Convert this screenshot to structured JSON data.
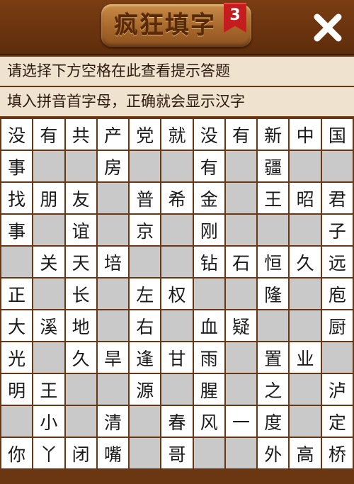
{
  "header": {
    "title": "疯狂填字",
    "level": "3",
    "close_icon": "close-icon"
  },
  "hints": [
    "请选择下方空格在此查看提示答题",
    "填入拼音首字母，正确就会显示汉字"
  ],
  "colors": {
    "board_border": "#6b3712",
    "cell_white": "#ffffff",
    "cell_block": "#c9c9c9",
    "hint_bg": "#efe2cf",
    "ribbon": "#c51d1d"
  },
  "grid": [
    [
      "没",
      "有",
      "共",
      "产",
      "党",
      "就",
      "没",
      "有",
      "新",
      "中",
      "国"
    ],
    [
      "事",
      "#",
      "#",
      "房",
      "#",
      "#",
      "有",
      "#",
      "疆",
      "#",
      "#"
    ],
    [
      "找",
      "朋",
      "友",
      "#",
      "普",
      "希",
      "金",
      "#",
      "王",
      "昭",
      "君"
    ],
    [
      "事",
      "#",
      "谊",
      "#",
      "京",
      "#",
      "刚",
      "#",
      "#",
      "#",
      "子"
    ],
    [
      "#",
      "关",
      "天",
      "培",
      "#",
      "#",
      "钻",
      "石",
      "恒",
      "久",
      "远"
    ],
    [
      "正",
      "#",
      "长",
      "#",
      "左",
      "权",
      "#",
      "#",
      "隆",
      "#",
      "庖"
    ],
    [
      "大",
      "溪",
      "地",
      "#",
      "右",
      "#",
      "血",
      "疑",
      "#",
      "#",
      "厨"
    ],
    [
      "光",
      "#",
      "久",
      "旱",
      "逢",
      "甘",
      "雨",
      "#",
      "置",
      "业",
      "#"
    ],
    [
      "明",
      "王",
      "#",
      "#",
      "源",
      "#",
      "腥",
      "#",
      "之",
      "#",
      "泸"
    ],
    [
      "#",
      "小",
      "#",
      "清",
      "#",
      "春",
      "风",
      "一",
      "度",
      "#",
      "定"
    ],
    [
      "你",
      "丫",
      "闭",
      "嘴",
      "#",
      "哥",
      "#",
      "#",
      "外",
      "高",
      "桥"
    ]
  ]
}
